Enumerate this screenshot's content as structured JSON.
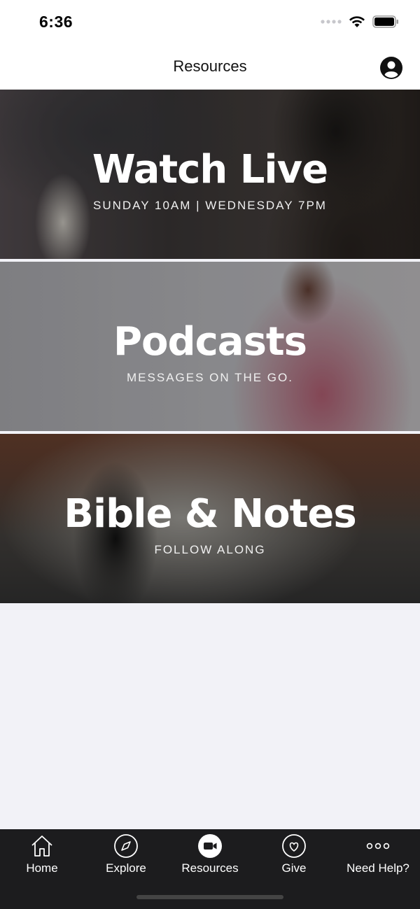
{
  "status": {
    "time": "6:36"
  },
  "header": {
    "title": "Resources",
    "profile_icon": "person-circle-icon"
  },
  "cards": [
    {
      "title": "Watch Live",
      "subtitle": "SUNDAY 10AM | WEDNESDAY 7PM"
    },
    {
      "title": "Podcasts",
      "subtitle": "MESSAGES ON THE GO."
    },
    {
      "title": "Bible & Notes",
      "subtitle": "FOLLOW ALONG"
    }
  ],
  "tabs": [
    {
      "label": "Home",
      "icon": "home-icon",
      "selected": false
    },
    {
      "label": "Explore",
      "icon": "compass-icon",
      "selected": false
    },
    {
      "label": "Resources",
      "icon": "video-camera-icon",
      "selected": true
    },
    {
      "label": "Give",
      "icon": "heart-icon",
      "selected": false
    },
    {
      "label": "Need Help?",
      "icon": "more-dots-icon",
      "selected": false
    }
  ],
  "colors": {
    "tab_bar": "#1c1c1e",
    "background": "#f2f2f7",
    "card_text": "#ffffff"
  }
}
